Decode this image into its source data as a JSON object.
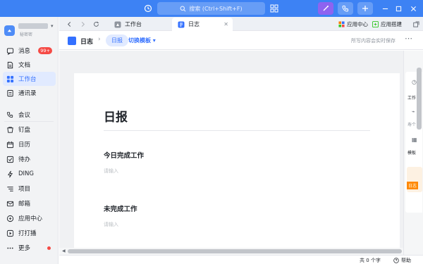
{
  "topbar": {
    "search_placeholder": "搜索 (Ctrl+Shift+F)",
    "brand_color": "#3d82f4"
  },
  "org": {
    "subtitle": "秘密密"
  },
  "sidebar": {
    "items": [
      {
        "label": "消息",
        "icon": "message-icon",
        "badge": "99+"
      },
      {
        "label": "文档",
        "icon": "document-icon"
      },
      {
        "label": "工作台",
        "icon": "workbench-icon",
        "active": true
      },
      {
        "label": "通讯录",
        "icon": "contacts-icon"
      },
      {
        "label": "会议",
        "icon": "meeting-icon"
      },
      {
        "label": "钉盘",
        "icon": "drive-icon"
      },
      {
        "label": "日历",
        "icon": "calendar-icon"
      },
      {
        "label": "待办",
        "icon": "todo-icon"
      },
      {
        "label": "DING",
        "icon": "ding-icon"
      },
      {
        "label": "项目",
        "icon": "project-icon"
      },
      {
        "label": "邮箱",
        "icon": "mail-icon"
      },
      {
        "label": "应用中心",
        "icon": "app-center-icon"
      },
      {
        "label": "打打播",
        "icon": "live-icon"
      },
      {
        "label": "更多",
        "icon": "more-icon",
        "dot": true
      }
    ]
  },
  "tabs": [
    {
      "label": "工作台",
      "icon": "workbench-icon"
    },
    {
      "label": "日志",
      "icon": "log-icon",
      "active": true
    }
  ],
  "tabbar_right": {
    "app_center": "应用中心",
    "app_build": "应用搭建"
  },
  "doc": {
    "breadcrumb_title": "日志",
    "template_chip": "日报",
    "switch_template": "切换模板",
    "save_status": "所写内容会实时保存",
    "heading": "日报",
    "sections": [
      {
        "title": "今日完成工作",
        "placeholder": "请输入"
      },
      {
        "title": "未完成工作",
        "placeholder": "请输入"
      }
    ]
  },
  "right_panel": {
    "items": [
      "工作",
      "寿个",
      "模板"
    ],
    "thumb_label": "日志"
  },
  "statusbar": {
    "word_count": "共 0 个字",
    "help": "帮助"
  }
}
